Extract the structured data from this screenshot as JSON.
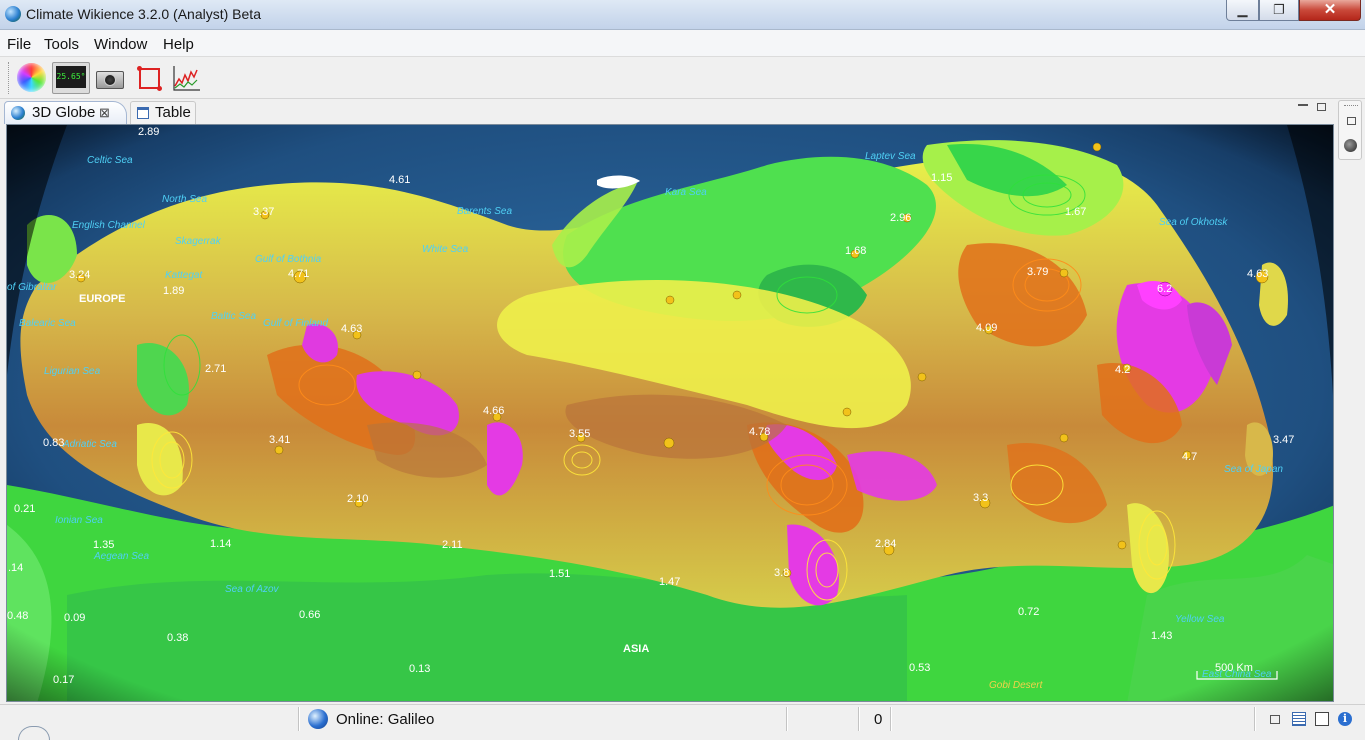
{
  "window": {
    "title": "Climate Wikience 3.2.0 (Analyst) Beta",
    "buttons": {
      "minimize": "▁",
      "maximize": "❐",
      "close": "✕"
    }
  },
  "menu": [
    "File",
    "Tools",
    "Window",
    "Help"
  ],
  "toolbar": {
    "temperature_display": "25.65°",
    "icons": [
      "color-palette-icon",
      "temperature-display-icon",
      "camera-icon",
      "selection-rectangle-icon",
      "chart-icon"
    ]
  },
  "tabs": {
    "globe": {
      "label": "3D Globe",
      "close": "⊠"
    },
    "table": {
      "label": "Table"
    }
  },
  "map": {
    "sea_labels": [
      "Celtic Sea",
      "North Sea",
      "English Channel",
      "Skagerrak",
      "Kattegat",
      "Baltic Sea",
      "Gulf of Bothnia",
      "Gulf of Finland",
      "Barents Sea",
      "White Sea",
      "Kara Sea",
      "Laptev Sea",
      "Sea of Okhotsk",
      "Sea of Japan",
      "Yellow Sea",
      "East China Sea",
      "of Gibraltar",
      "Balearic Sea",
      "Ligurian Sea",
      "Adriatic Sea",
      "Ionian Sea",
      "Aegean Sea",
      "Sea of Azov",
      "Gobi Desert"
    ],
    "region_labels": [
      "EUROPE",
      "ASIA"
    ],
    "values": [
      "2.89",
      "3.37",
      "4.61",
      "3.24",
      "1.89",
      "4.71",
      "4.63",
      "2.71",
      "3.41",
      "4.66",
      "3.55",
      "4.78",
      "2.10",
      "2.11",
      "1.51",
      "1.47",
      "3.8",
      "2.84",
      "3.3",
      "3.79",
      "4.09",
      "6.2",
      "4.63",
      "3.47",
      "1.67",
      "1.15",
      "1.68",
      "2.96",
      "0.83",
      "0.21",
      "1.35",
      "1.14",
      "0.66",
      "0.38",
      "0.48",
      "0.09",
      "0.17",
      "0.13",
      "0.53",
      "0.72",
      "1.43",
      ".14",
      "4.7",
      "4.2"
    ],
    "scale_label": "500 Km"
  },
  "status": {
    "connection": "Online: Galileo",
    "count": "0"
  }
}
